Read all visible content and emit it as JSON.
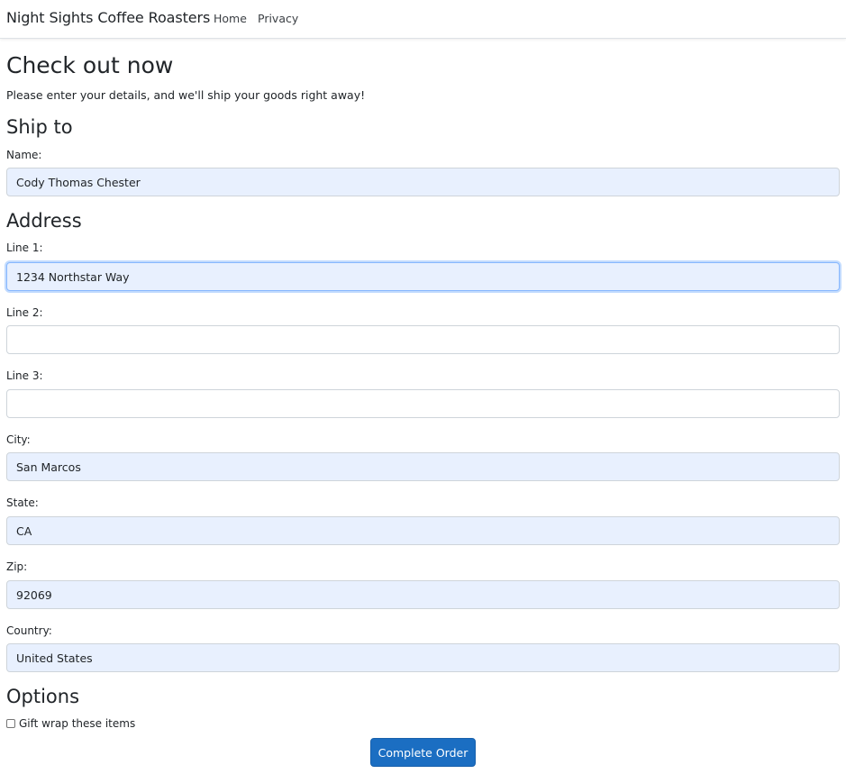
{
  "nav": {
    "brand": "Night Sights Coffee Roasters",
    "links": [
      "Home",
      "Privacy"
    ]
  },
  "page": {
    "title": "Check out now",
    "subtitle": "Please enter your details, and we'll ship your goods right away!"
  },
  "ship_to": {
    "heading": "Ship to",
    "name_label": "Name:",
    "name_value": "Cody Thomas Chester"
  },
  "address": {
    "heading": "Address",
    "line1_label": "Line 1:",
    "line1_value": "1234 Northstar Way",
    "line2_label": "Line 2:",
    "line2_value": "",
    "line3_label": "Line 3:",
    "line3_value": "",
    "city_label": "City:",
    "city_value": "San Marcos",
    "state_label": "State:",
    "state_value": "CA",
    "zip_label": "Zip:",
    "zip_value": "92069",
    "country_label": "Country:",
    "country_value": "United States"
  },
  "options": {
    "heading": "Options",
    "gift_wrap_label": "Gift wrap these items",
    "gift_wrap_checked": false
  },
  "submit_label": "Complete Order",
  "colors": {
    "accent": "#1b6ec2",
    "autofill_bg": "#e8f0fe"
  }
}
